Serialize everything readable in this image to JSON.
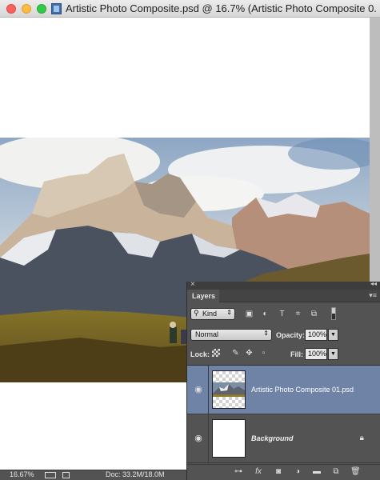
{
  "window": {
    "title": "Artistic Photo Composite.psd @ 16.7% (Artistic Photo Composite 0..."
  },
  "status": {
    "zoom": "16.67%",
    "doc": "Doc: 33.2M/18.0M"
  },
  "layers_panel": {
    "tab_label": "Layers",
    "filter_kind": "Kind",
    "blend_mode": "Normal",
    "opacity_label": "Opacity:",
    "opacity_value": "100%",
    "lock_label": "Lock:",
    "fill_label": "Fill:",
    "fill_value": "100%",
    "layers": [
      {
        "name": "Artistic Photo Composite 01.psd",
        "selected": true,
        "visible": true
      },
      {
        "name": "Background",
        "selected": false,
        "visible": true,
        "locked": true
      }
    ],
    "footer_icons": [
      "link-icon",
      "fx-icon",
      "mask-icon",
      "adjustment-icon",
      "group-folder-icon",
      "new-layer-icon",
      "trash-icon"
    ]
  },
  "colors": {
    "panel_bg": "#535353",
    "selection": "#6f83a6"
  }
}
